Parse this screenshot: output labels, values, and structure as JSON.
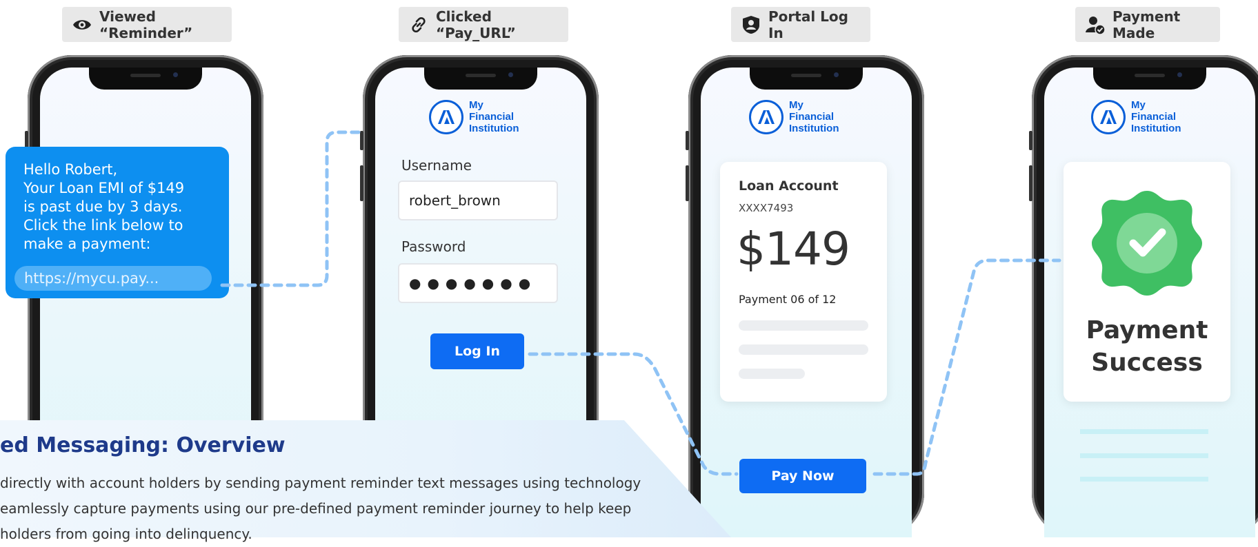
{
  "steps": [
    {
      "label": "Viewed “Reminder”",
      "icon": "eye-icon"
    },
    {
      "label": "Clicked “Pay_URL”",
      "icon": "link-icon"
    },
    {
      "label": "Portal Log In",
      "icon": "user-badge-icon"
    },
    {
      "label": "Payment Made",
      "icon": "user-check-icon"
    }
  ],
  "sms": {
    "lines": [
      "Hello Robert,",
      "Your Loan EMI of $149",
      "is past due by 3 days.",
      "Click the link below to",
      "make a payment:"
    ],
    "link": "https://mycu.pay..."
  },
  "brand": {
    "name": "My\nFinancial\nInstitution",
    "color": "#0a5fd8"
  },
  "login": {
    "username_label": "Username",
    "username_value": "robert_brown",
    "password_label": "Password",
    "password_value": "●●●●●●●",
    "login_button": "Log In"
  },
  "loan": {
    "title": "Loan Account",
    "account": "XXXX7493",
    "amount": "$149",
    "payment": "Payment 06 of 12",
    "pay_button": "Pay Now"
  },
  "success": {
    "line1": "Payment",
    "line2": "Success",
    "badge_color": "#3fbf63"
  },
  "overview": {
    "title": "ed Messaging: Overview",
    "lines": [
      "directly with account holders by sending payment reminder text messages using technology",
      "eamlessly capture payments using our pre-defined payment reminder journey to help keep",
      "holders from going into delinquency."
    ]
  },
  "colors": {
    "accent": "#0e6cf3",
    "connector": "#8fc3f5",
    "pill_bg": "#e8e8e8"
  }
}
